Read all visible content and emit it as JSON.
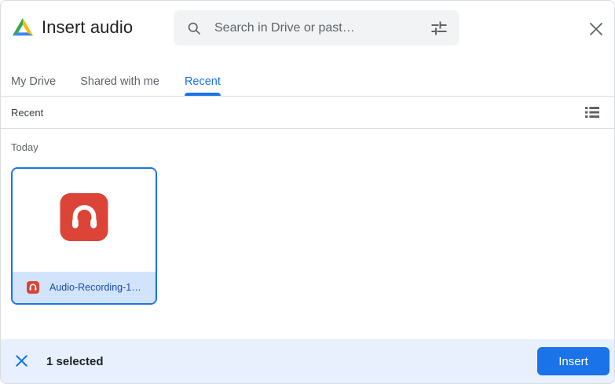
{
  "header": {
    "title": "Insert audio",
    "search": {
      "placeholder": "Search in Drive or past…"
    }
  },
  "tabs": [
    {
      "label": "My Drive",
      "active": false
    },
    {
      "label": "Shared with me",
      "active": false
    },
    {
      "label": "Recent",
      "active": true
    }
  ],
  "listing": {
    "section_label": "Recent",
    "group_label": "Today",
    "files": [
      {
        "name": "Audio-Recording-1…",
        "type": "audio",
        "selected": true
      }
    ]
  },
  "footer": {
    "selection_text": "1 selected",
    "insert_label": "Insert"
  },
  "colors": {
    "accent_blue": "#1a73e8",
    "audio_red": "#db4437",
    "footer_bg": "#e8f0fe",
    "file_strip_bg": "#d2e3fc",
    "filename_text": "#174ea6",
    "divider": "#dadce0",
    "search_bg": "#f1f3f4",
    "muted_text": "#5f6368"
  }
}
